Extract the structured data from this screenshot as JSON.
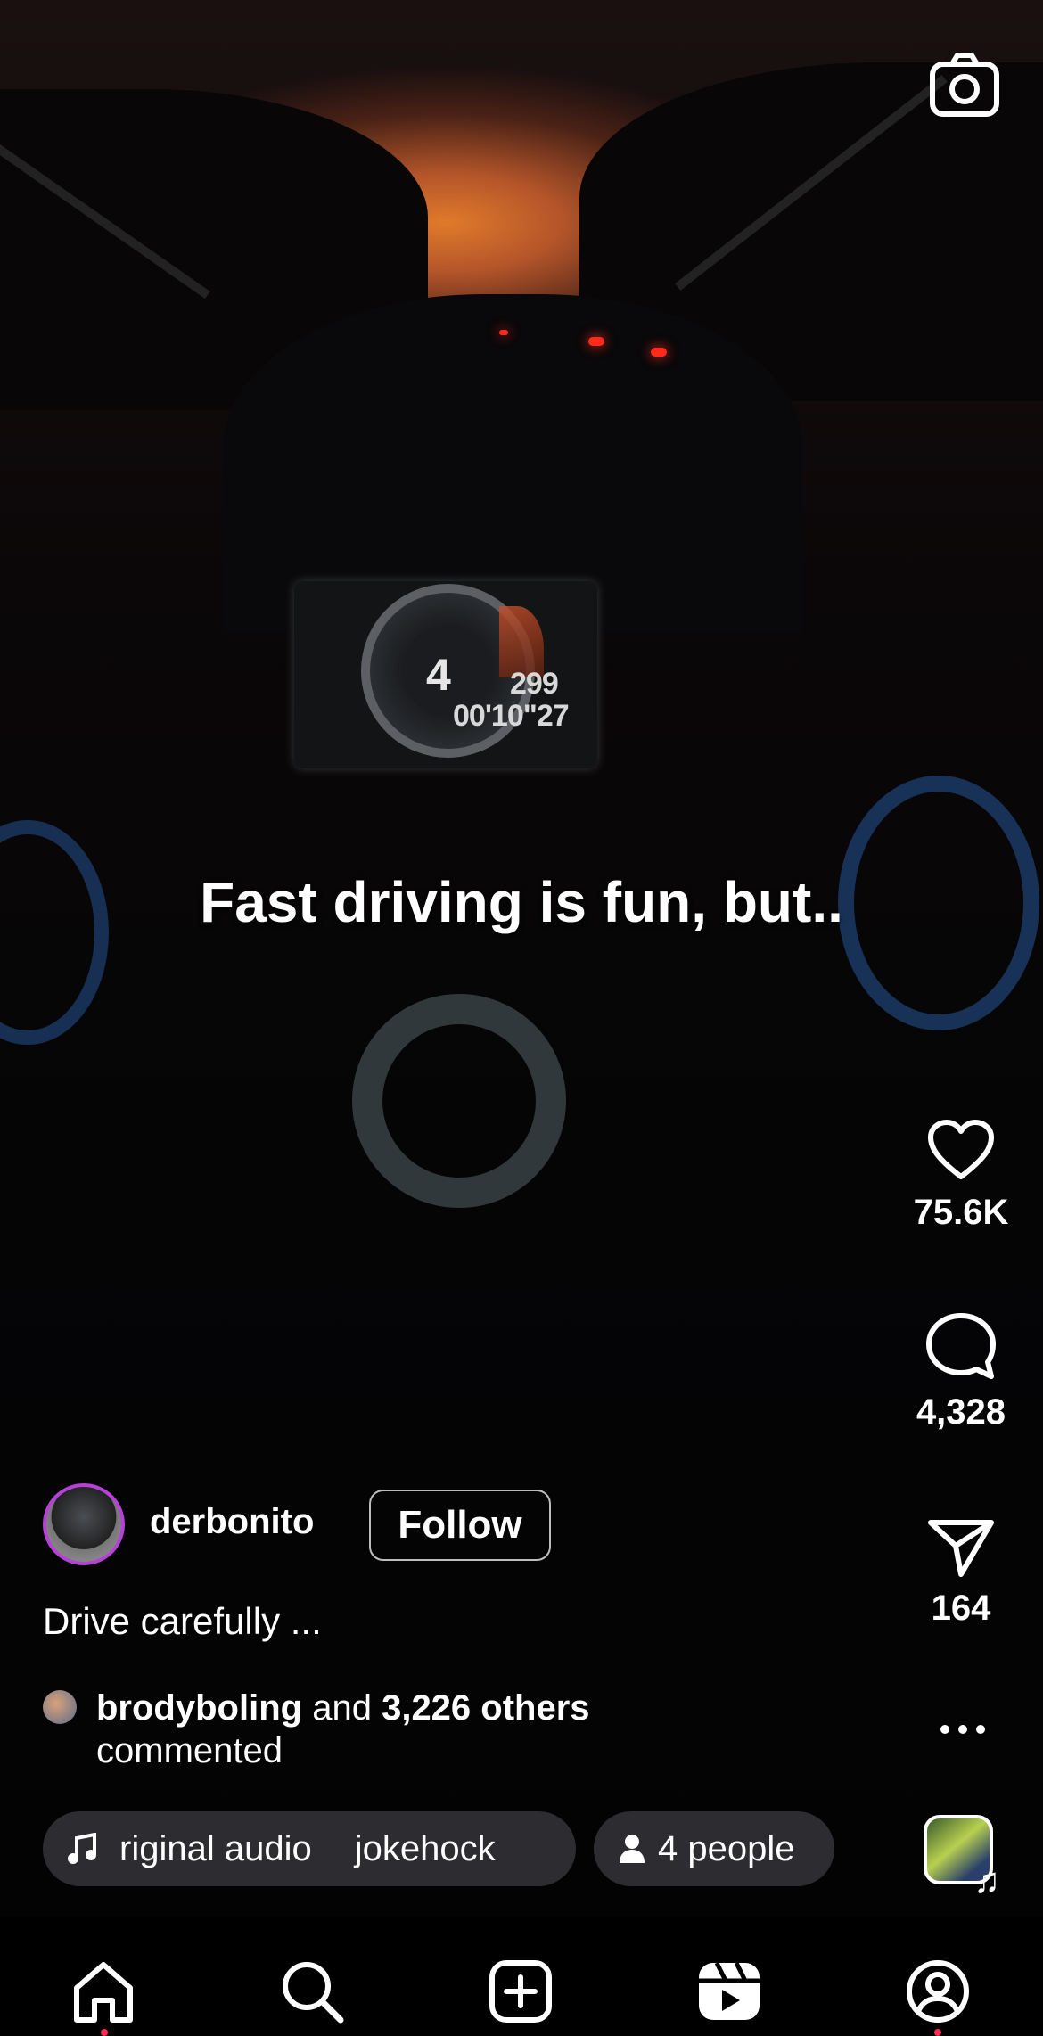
{
  "video": {
    "overlay_text": "Fast driving is fun, but..",
    "dash_gear": "4",
    "dash_speed": "299",
    "dash_time": "00'10\"27"
  },
  "actions": {
    "likes": "75.6K",
    "comments": "4,328",
    "shares": "164"
  },
  "post": {
    "username": "derbonito",
    "follow_label": "Follow",
    "caption": "Drive carefully ...",
    "commenter_name": "brodyboling",
    "commenter_and": "and",
    "commenter_others": "3,226 others",
    "commenter_tail": "commented"
  },
  "audio_pill": {
    "text": "riginal audio",
    "artist": "jokehock"
  },
  "people_pill": {
    "label": "4 people"
  },
  "colors": {
    "avatar_ring": "#b541d6",
    "notification_dot": "#ff2d55"
  },
  "icons": {
    "camera": "camera-icon",
    "like": "heart-icon",
    "comment": "comment-icon",
    "share": "send-icon",
    "more": "more-icon",
    "music": "music-note-icon",
    "person": "person-icon",
    "nav": [
      "home-icon",
      "search-icon",
      "create-icon",
      "reels-icon",
      "profile-icon"
    ]
  }
}
